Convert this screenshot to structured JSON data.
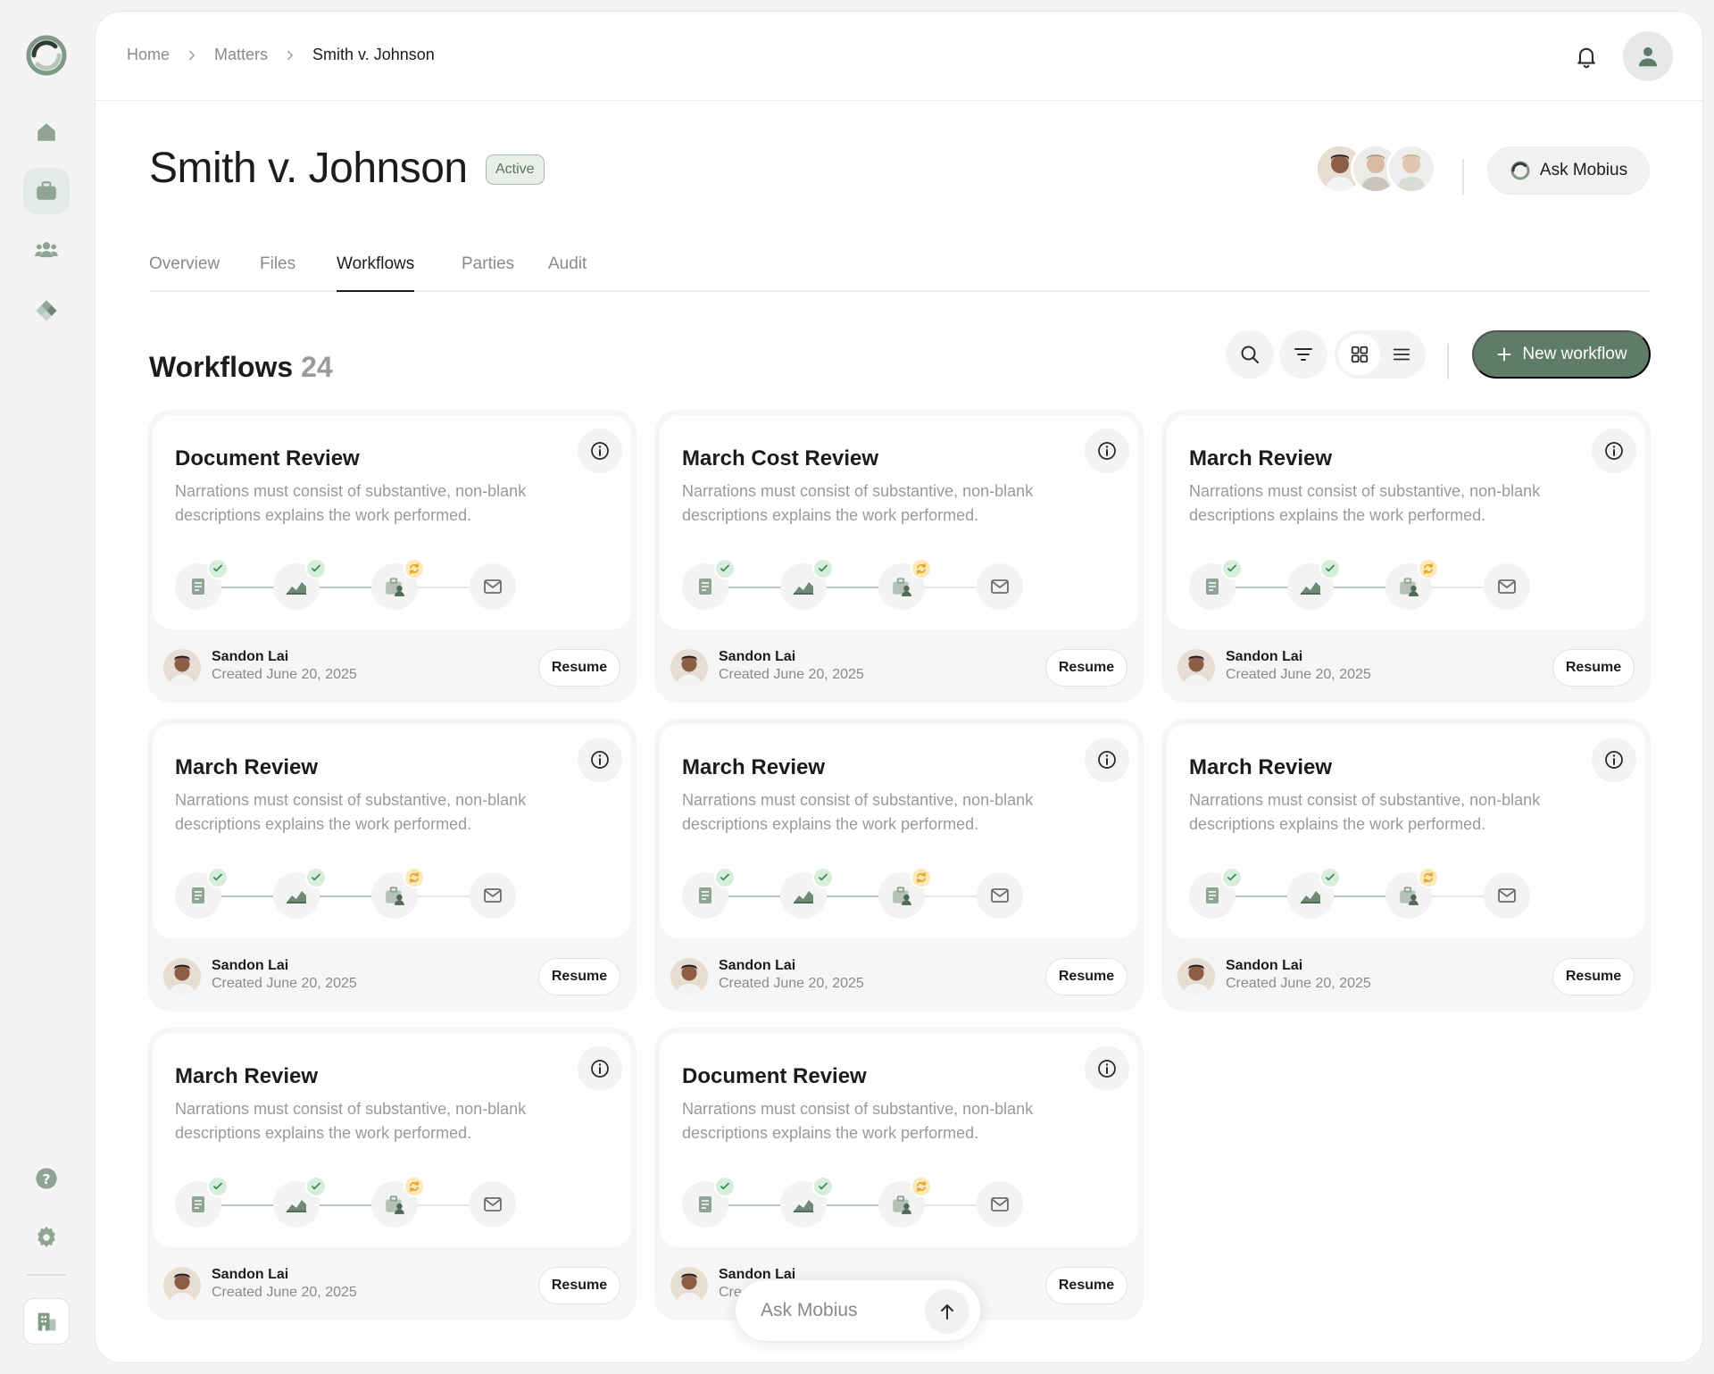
{
  "breadcrumb": {
    "items": [
      "Home",
      "Matters"
    ],
    "current": "Smith v. Johnson"
  },
  "matter": {
    "title": "Smith v. Johnson",
    "status": "Active"
  },
  "header": {
    "ask_label": "Ask Mobius"
  },
  "tabs": [
    {
      "label": "Overview"
    },
    {
      "label": "Files"
    },
    {
      "label": "Workflows",
      "active": true
    },
    {
      "label": "Parties"
    },
    {
      "label": "Audit"
    }
  ],
  "workflows": {
    "title": "Workflows",
    "count": "24",
    "new_label": "New workflow"
  },
  "cards": [
    {
      "title": "Document Review",
      "desc": "Narrations must consist of substantive, non-blank descriptions explains the work performed.",
      "user": "Sandon Lai",
      "created": "Created June 20, 2025",
      "action": "Resume"
    },
    {
      "title": "March Cost Review",
      "desc": "Narrations must consist of substantive, non-blank descriptions explains the work performed.",
      "user": "Sandon Lai",
      "created": "Created June 20, 2025",
      "action": "Resume"
    },
    {
      "title": "March Review",
      "desc": "Narrations must consist of substantive, non-blank descriptions explains the work performed.",
      "user": "Sandon Lai",
      "created": "Created June 20, 2025",
      "action": "Resume"
    },
    {
      "title": "March Review",
      "desc": "Narrations must consist of substantive, non-blank descriptions explains the work performed.",
      "user": "Sandon Lai",
      "created": "Created June 20, 2025",
      "action": "Resume"
    },
    {
      "title": "March Review",
      "desc": "Narrations must consist of substantive, non-blank descriptions explains the work performed.",
      "user": "Sandon Lai",
      "created": "Created June 20, 2025",
      "action": "Resume"
    },
    {
      "title": "March Review",
      "desc": "Narrations must consist of substantive, non-blank descriptions explains the work performed.",
      "user": "Sandon Lai",
      "created": "Created June 20, 2025",
      "action": "Resume"
    },
    {
      "title": "March Review",
      "desc": "Narrations must consist of substantive, non-blank descriptions explains the work performed.",
      "user": "Sandon Lai",
      "created": "Created June 20, 2025",
      "action": "Resume"
    },
    {
      "title": "Document Review",
      "desc": "Narrations must consist of substantive, non-blank descriptions explains the work performed.",
      "user": "Sandon Lai",
      "created": "Created June 20, 2025",
      "action": "Resume"
    }
  ],
  "pipeline_steps": [
    {
      "icon": "document-icon",
      "state": "done"
    },
    {
      "icon": "chart-icon",
      "state": "done"
    },
    {
      "icon": "briefcase-user-icon",
      "state": "pending"
    },
    {
      "icon": "mail-icon",
      "state": "todo"
    }
  ],
  "askbar": {
    "placeholder": "Ask Mobius"
  },
  "colors": {
    "accent": "#5e7c68",
    "done_badge": "#d8eedc",
    "pending_badge": "#fde9b8"
  }
}
